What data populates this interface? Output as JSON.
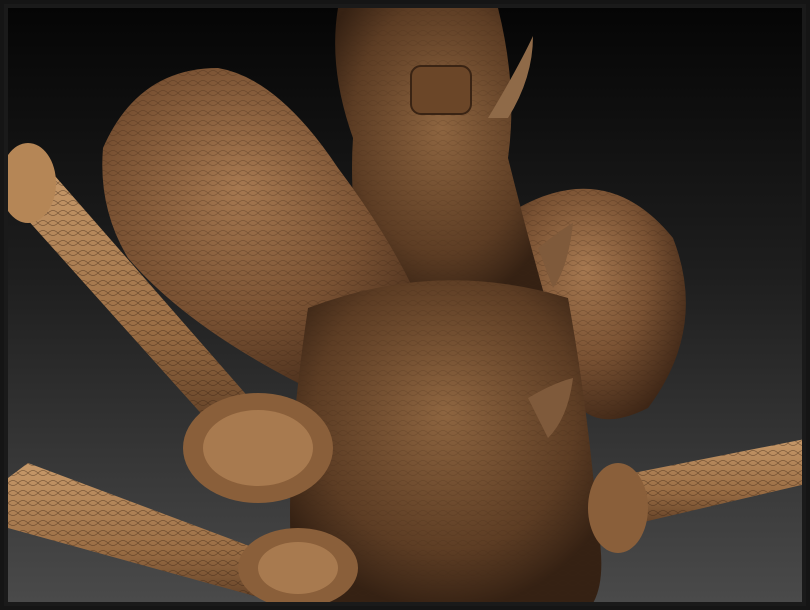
{
  "scene": {
    "subject": "sculpt-render",
    "colors": {
      "background_top": "#050505",
      "background_bottom": "#4a4a4a",
      "skin_light": "#b98a5c",
      "skin_mid": "#8a5f3a",
      "skin_dark": "#4a2f1c"
    }
  }
}
